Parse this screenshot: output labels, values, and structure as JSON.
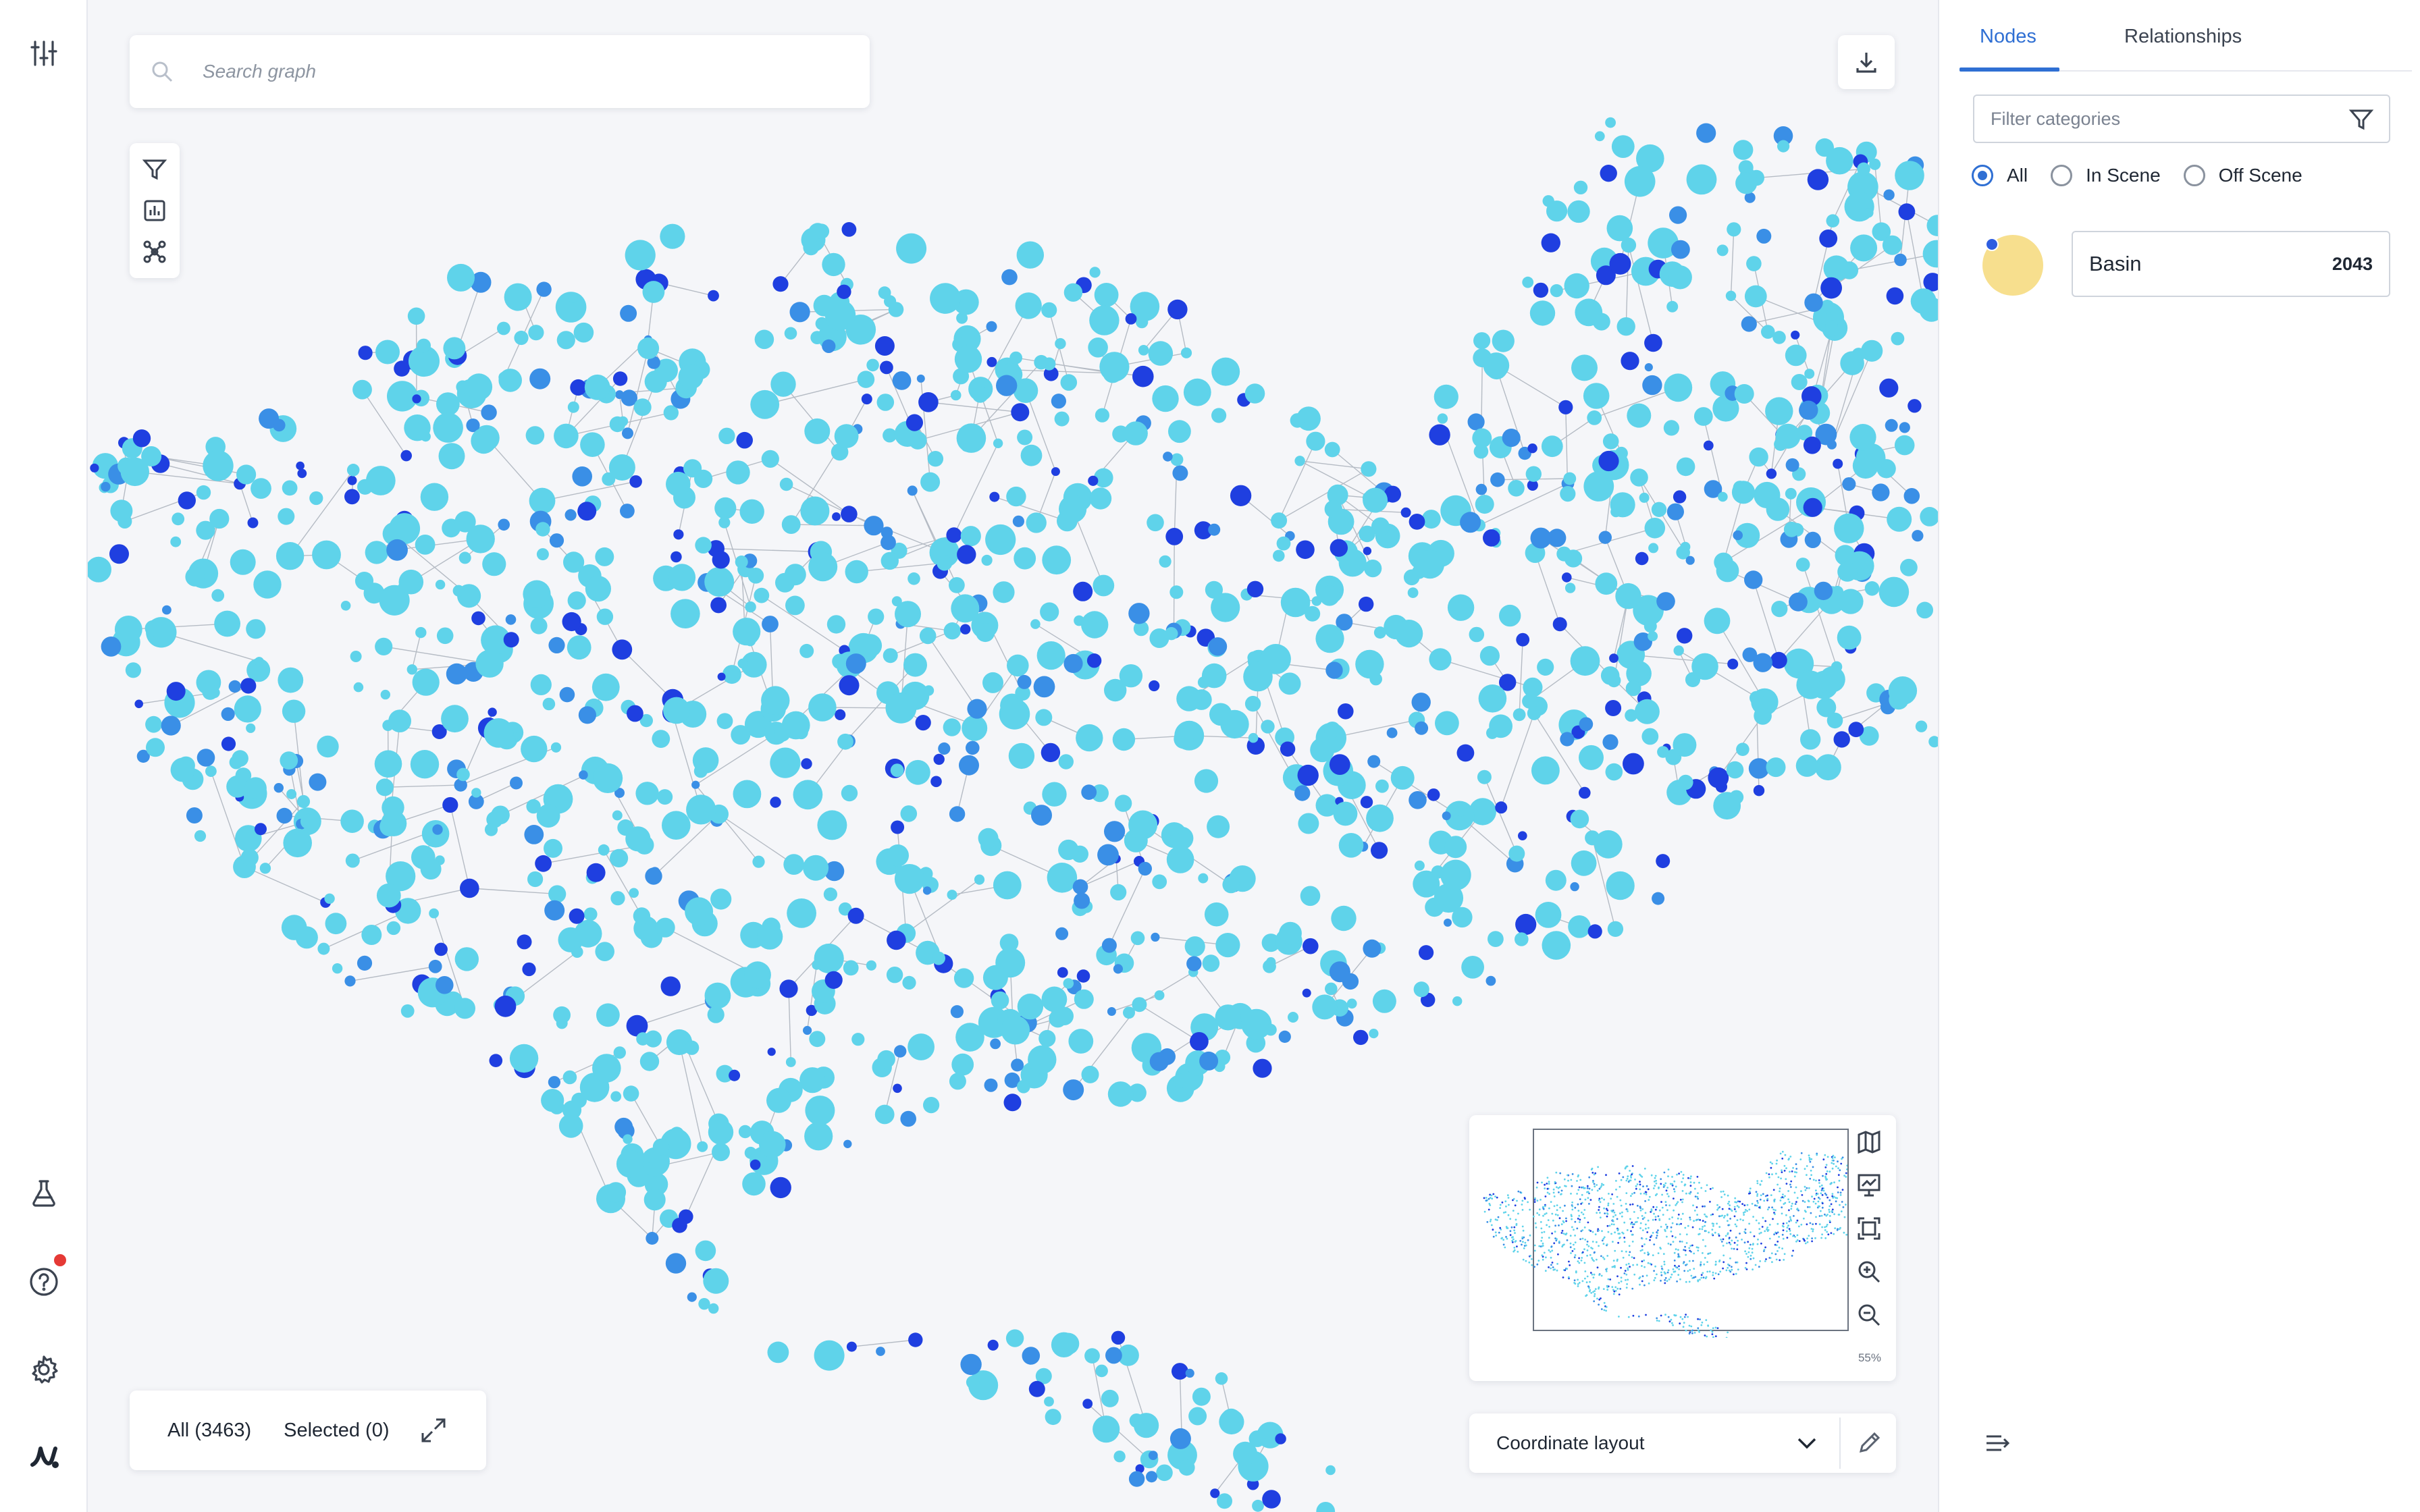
{
  "search": {
    "placeholder": "Search graph"
  },
  "status": {
    "all_label": "All (3463)",
    "selected_label": "Selected (0)"
  },
  "minimap": {
    "zoom": "55%"
  },
  "layout": {
    "selected": "Coordinate layout"
  },
  "panel": {
    "tabs": [
      {
        "label": "Nodes",
        "active": true
      },
      {
        "label": "Relationships",
        "active": false
      }
    ],
    "filter_placeholder": "Filter categories",
    "scene_options": [
      {
        "label": "All",
        "checked": true
      },
      {
        "label": "In Scene",
        "checked": false
      },
      {
        "label": "Off Scene",
        "checked": false
      }
    ],
    "categories": [
      {
        "name": "Basin",
        "count": "2043",
        "color": "#f7df8e"
      }
    ]
  },
  "colors": {
    "node_light": "#5fd3ea",
    "node_mid": "#3a8fe6",
    "node_dark": "#1f3fe0",
    "accent": "#2f6fd3",
    "notification": "#e53935"
  },
  "icons": [
    "sliders-icon",
    "flask-icon",
    "help-icon",
    "settings-icon",
    "brand-logo",
    "search-icon",
    "filter-icon",
    "bar-chart-icon",
    "network-icon",
    "download-icon",
    "expand-icon",
    "map-icon",
    "chart-line-icon",
    "fit-screen-icon",
    "zoom-in-icon",
    "zoom-out-icon",
    "chevron-down-icon",
    "edit-icon",
    "collapse-panel-icon"
  ]
}
